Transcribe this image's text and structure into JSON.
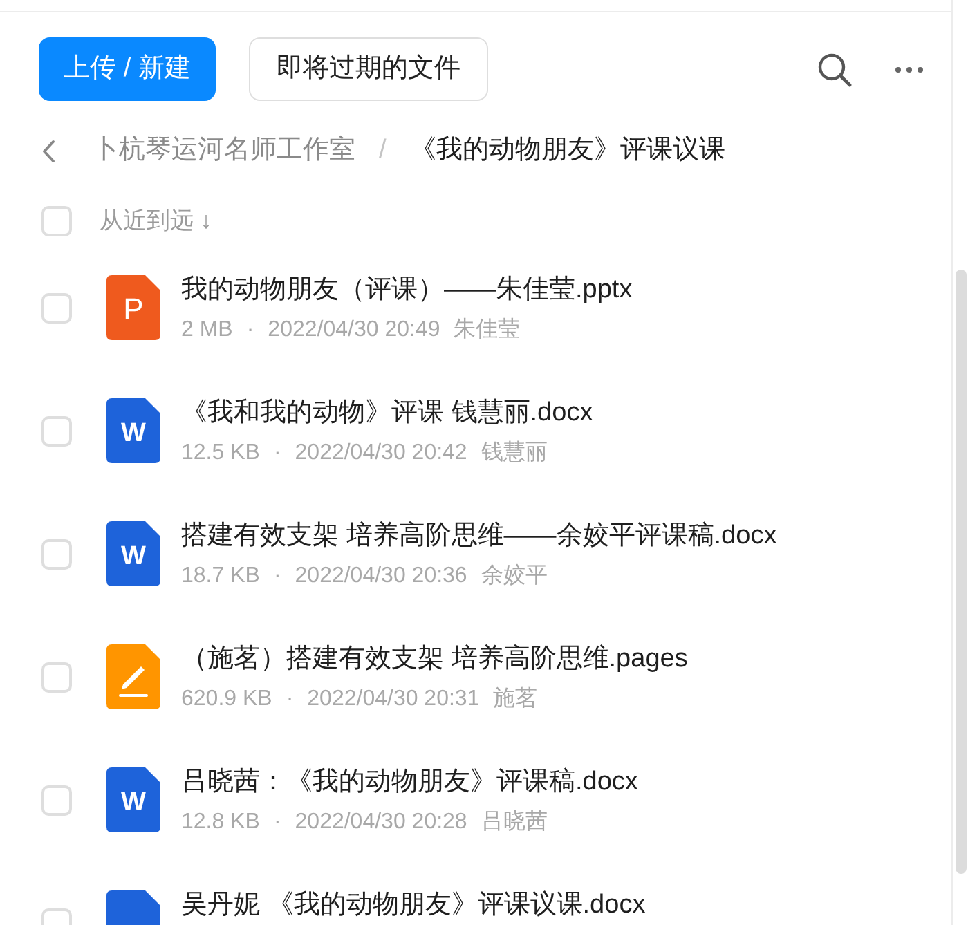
{
  "toolbar": {
    "primary_button": "上传 / 新建",
    "secondary_button": "即将过期的文件"
  },
  "breadcrumb": {
    "items": [
      {
        "label": "卜杭琴运河名师工作室",
        "current": false
      },
      {
        "label": "《我的动物朋友》评课议课",
        "current": true
      }
    ],
    "separator": "/"
  },
  "sort": {
    "select_all_checked": false,
    "label": "从近到远",
    "arrow": "↓"
  },
  "files": [
    {
      "kind": "presentation",
      "icon_letter": "P",
      "name": "我的动物朋友（评课）——朱佳莹.pptx",
      "size": "2 MB",
      "separator": "·",
      "modified": "2022/04/30 20:49",
      "owner": "朱佳莹",
      "checked": false
    },
    {
      "kind": "document",
      "icon_letter": "W",
      "name": "《我和我的动物》评课 钱慧丽.docx",
      "size": "12.5 KB",
      "separator": "·",
      "modified": "2022/04/30 20:42",
      "owner": "钱慧丽",
      "checked": false
    },
    {
      "kind": "document",
      "icon_letter": "W",
      "name": "搭建有效支架 培养高阶思维——余姣平评课稿.docx",
      "size": "18.7 KB",
      "separator": "·",
      "modified": "2022/04/30 20:36",
      "owner": "余姣平",
      "checked": false
    },
    {
      "kind": "pages",
      "name": "（施茗）搭建有效支架 培养高阶思维.pages",
      "size": "620.9 KB",
      "separator": "·",
      "modified": "2022/04/30 20:31",
      "owner": "施茗",
      "checked": false
    },
    {
      "kind": "document",
      "icon_letter": "W",
      "name": "吕晓茜：《我的动物朋友》评课稿.docx",
      "size": "12.8 KB",
      "separator": "·",
      "modified": "2022/04/30 20:28",
      "owner": "吕晓茜",
      "checked": false
    },
    {
      "kind": "document",
      "name": "吴丹妮 《我的动物朋友》评课议课.docx",
      "checked": false
    }
  ]
}
